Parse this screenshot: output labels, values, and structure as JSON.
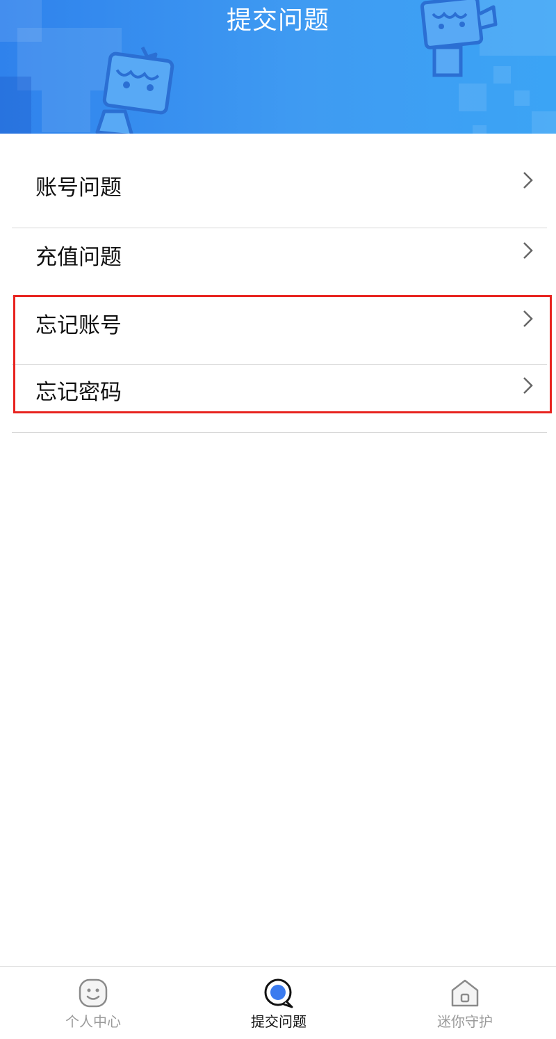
{
  "header": {
    "title": "提交问题"
  },
  "menu": {
    "items": [
      {
        "label": "账号问题"
      },
      {
        "label": "充值问题"
      },
      {
        "label": "忘记账号"
      },
      {
        "label": "忘记密码"
      }
    ]
  },
  "tabbar": {
    "items": [
      {
        "label": "个人中心",
        "icon": "smiley-face-icon"
      },
      {
        "label": "提交问题",
        "icon": "chat-bubble-icon",
        "active": true
      },
      {
        "label": "迷你守护",
        "icon": "home-shield-icon"
      }
    ]
  },
  "colors": {
    "header_blue": "#3b92f0",
    "highlight_red": "#e8231f",
    "active_tab_icon": "#3b7bef"
  }
}
